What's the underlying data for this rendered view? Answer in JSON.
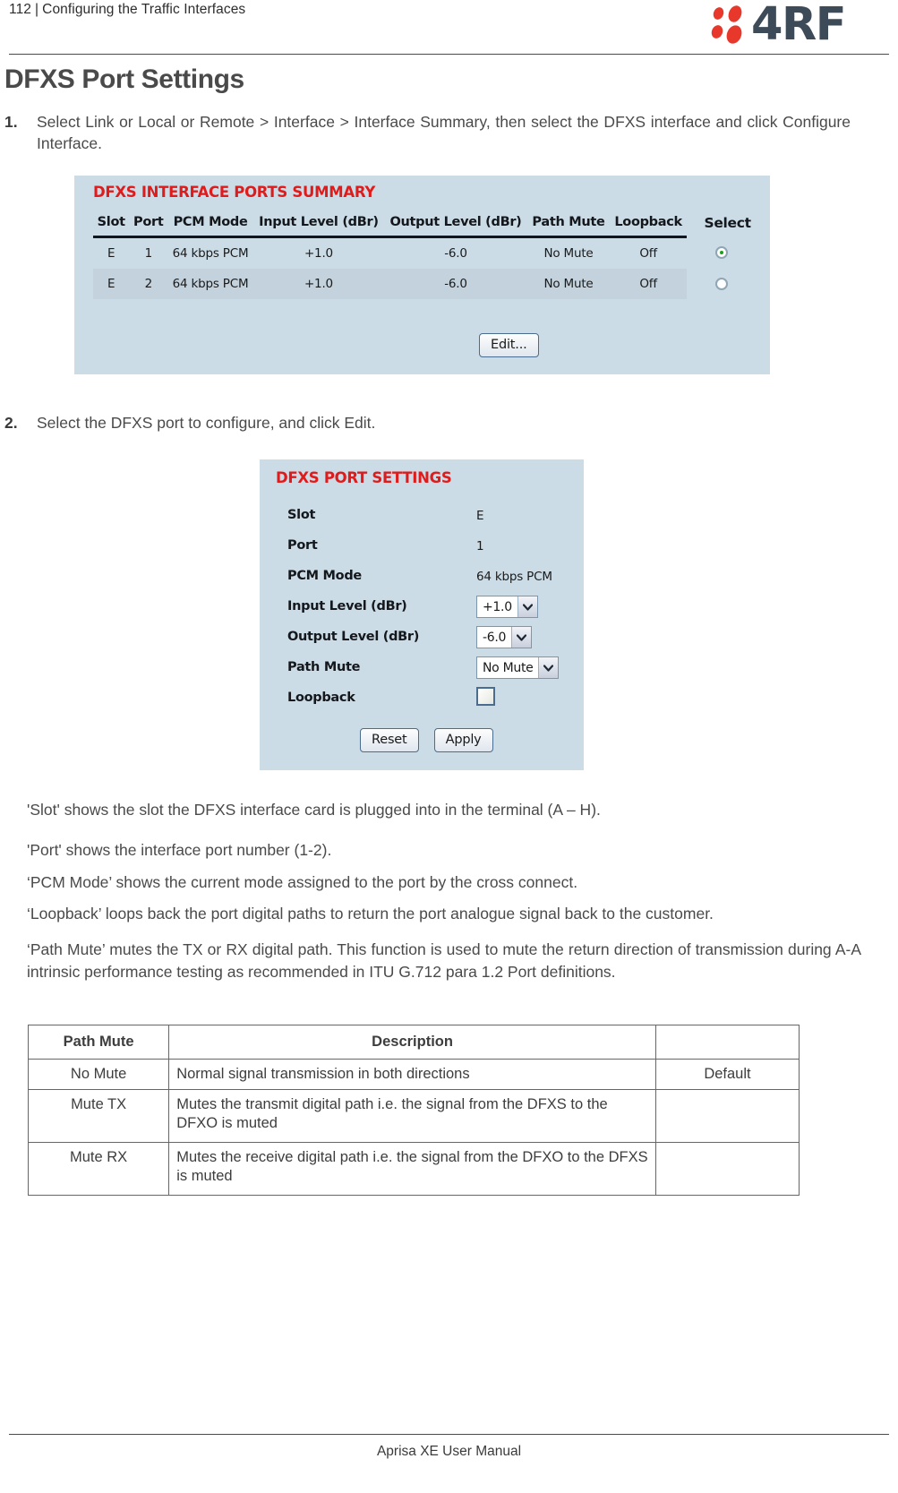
{
  "header": {
    "page_number": "112",
    "separator": "|",
    "chapter": "Configuring the Traffic Interfaces",
    "logo_text": "4RF"
  },
  "section_title": "DFXS Port Settings",
  "steps": [
    {
      "number": "1.",
      "text": "Select Link or Local or Remote > Interface > Interface Summary, then select the DFXS interface and click Configure Interface."
    },
    {
      "number": "2.",
      "text": "Select the DFXS port to configure, and click Edit."
    }
  ],
  "ports_summary": {
    "title": "DFXS INTERFACE PORTS SUMMARY",
    "columns": [
      "Slot",
      "Port",
      "PCM Mode",
      "Input Level (dBr)",
      "Output Level (dBr)",
      "Path Mute",
      "Loopback",
      "Select"
    ],
    "rows": [
      {
        "slot": "E",
        "port": "1",
        "pcm_mode": "64 kbps PCM",
        "input_level": "+1.0",
        "output_level": "-6.0",
        "path_mute": "No Mute",
        "loopback": "Off",
        "selected": true
      },
      {
        "slot": "E",
        "port": "2",
        "pcm_mode": "64 kbps PCM",
        "input_level": "+1.0",
        "output_level": "-6.0",
        "path_mute": "No Mute",
        "loopback": "Off",
        "selected": false
      }
    ],
    "edit_button": "Edit..."
  },
  "port_settings": {
    "title": "DFXS PORT SETTINGS",
    "fields": {
      "slot_label": "Slot",
      "slot_value": "E",
      "port_label": "Port",
      "port_value": "1",
      "pcm_mode_label": "PCM Mode",
      "pcm_mode_value": "64 kbps PCM",
      "input_level_label": "Input Level (dBr)",
      "input_level_value": "+1.0",
      "output_level_label": "Output Level (dBr)",
      "output_level_value": "-6.0",
      "path_mute_label": "Path Mute",
      "path_mute_value": "No Mute",
      "loopback_label": "Loopback",
      "loopback_checked": false
    },
    "reset_button": "Reset",
    "apply_button": "Apply"
  },
  "paragraphs": {
    "slot": "'Slot' shows the slot the DFXS interface card is plugged into in the terminal (A – H).",
    "port": "'Port' shows the interface port number (1-2).",
    "pcm_mode": "‘PCM Mode’ shows the current mode assigned to the port by the cross connect.",
    "loopback": "‘Loopback’ loops back the port digital paths to return the port analogue signal back to the customer.",
    "path_mute": "‘Path Mute’ mutes the TX or RX digital path. This function is used to mute the return direction of transmission during A-A intrinsic performance testing as recommended in ITU G.712 para 1.2 Port definitions."
  },
  "mute_table": {
    "headers": [
      "Path Mute",
      "Description",
      ""
    ],
    "rows": [
      {
        "mode": "No Mute",
        "description": "Normal signal transmission in both directions",
        "default": "Default"
      },
      {
        "mode": "Mute TX",
        "description": "Mutes the transmit digital path i.e. the signal from the DFXS to the DFXO is muted",
        "default": ""
      },
      {
        "mode": "Mute RX",
        "description": "Mutes the receive digital path i.e. the signal from the DFXO to the DFXS is muted",
        "default": ""
      }
    ]
  },
  "footer": {
    "text": "Aprisa XE User Manual"
  }
}
